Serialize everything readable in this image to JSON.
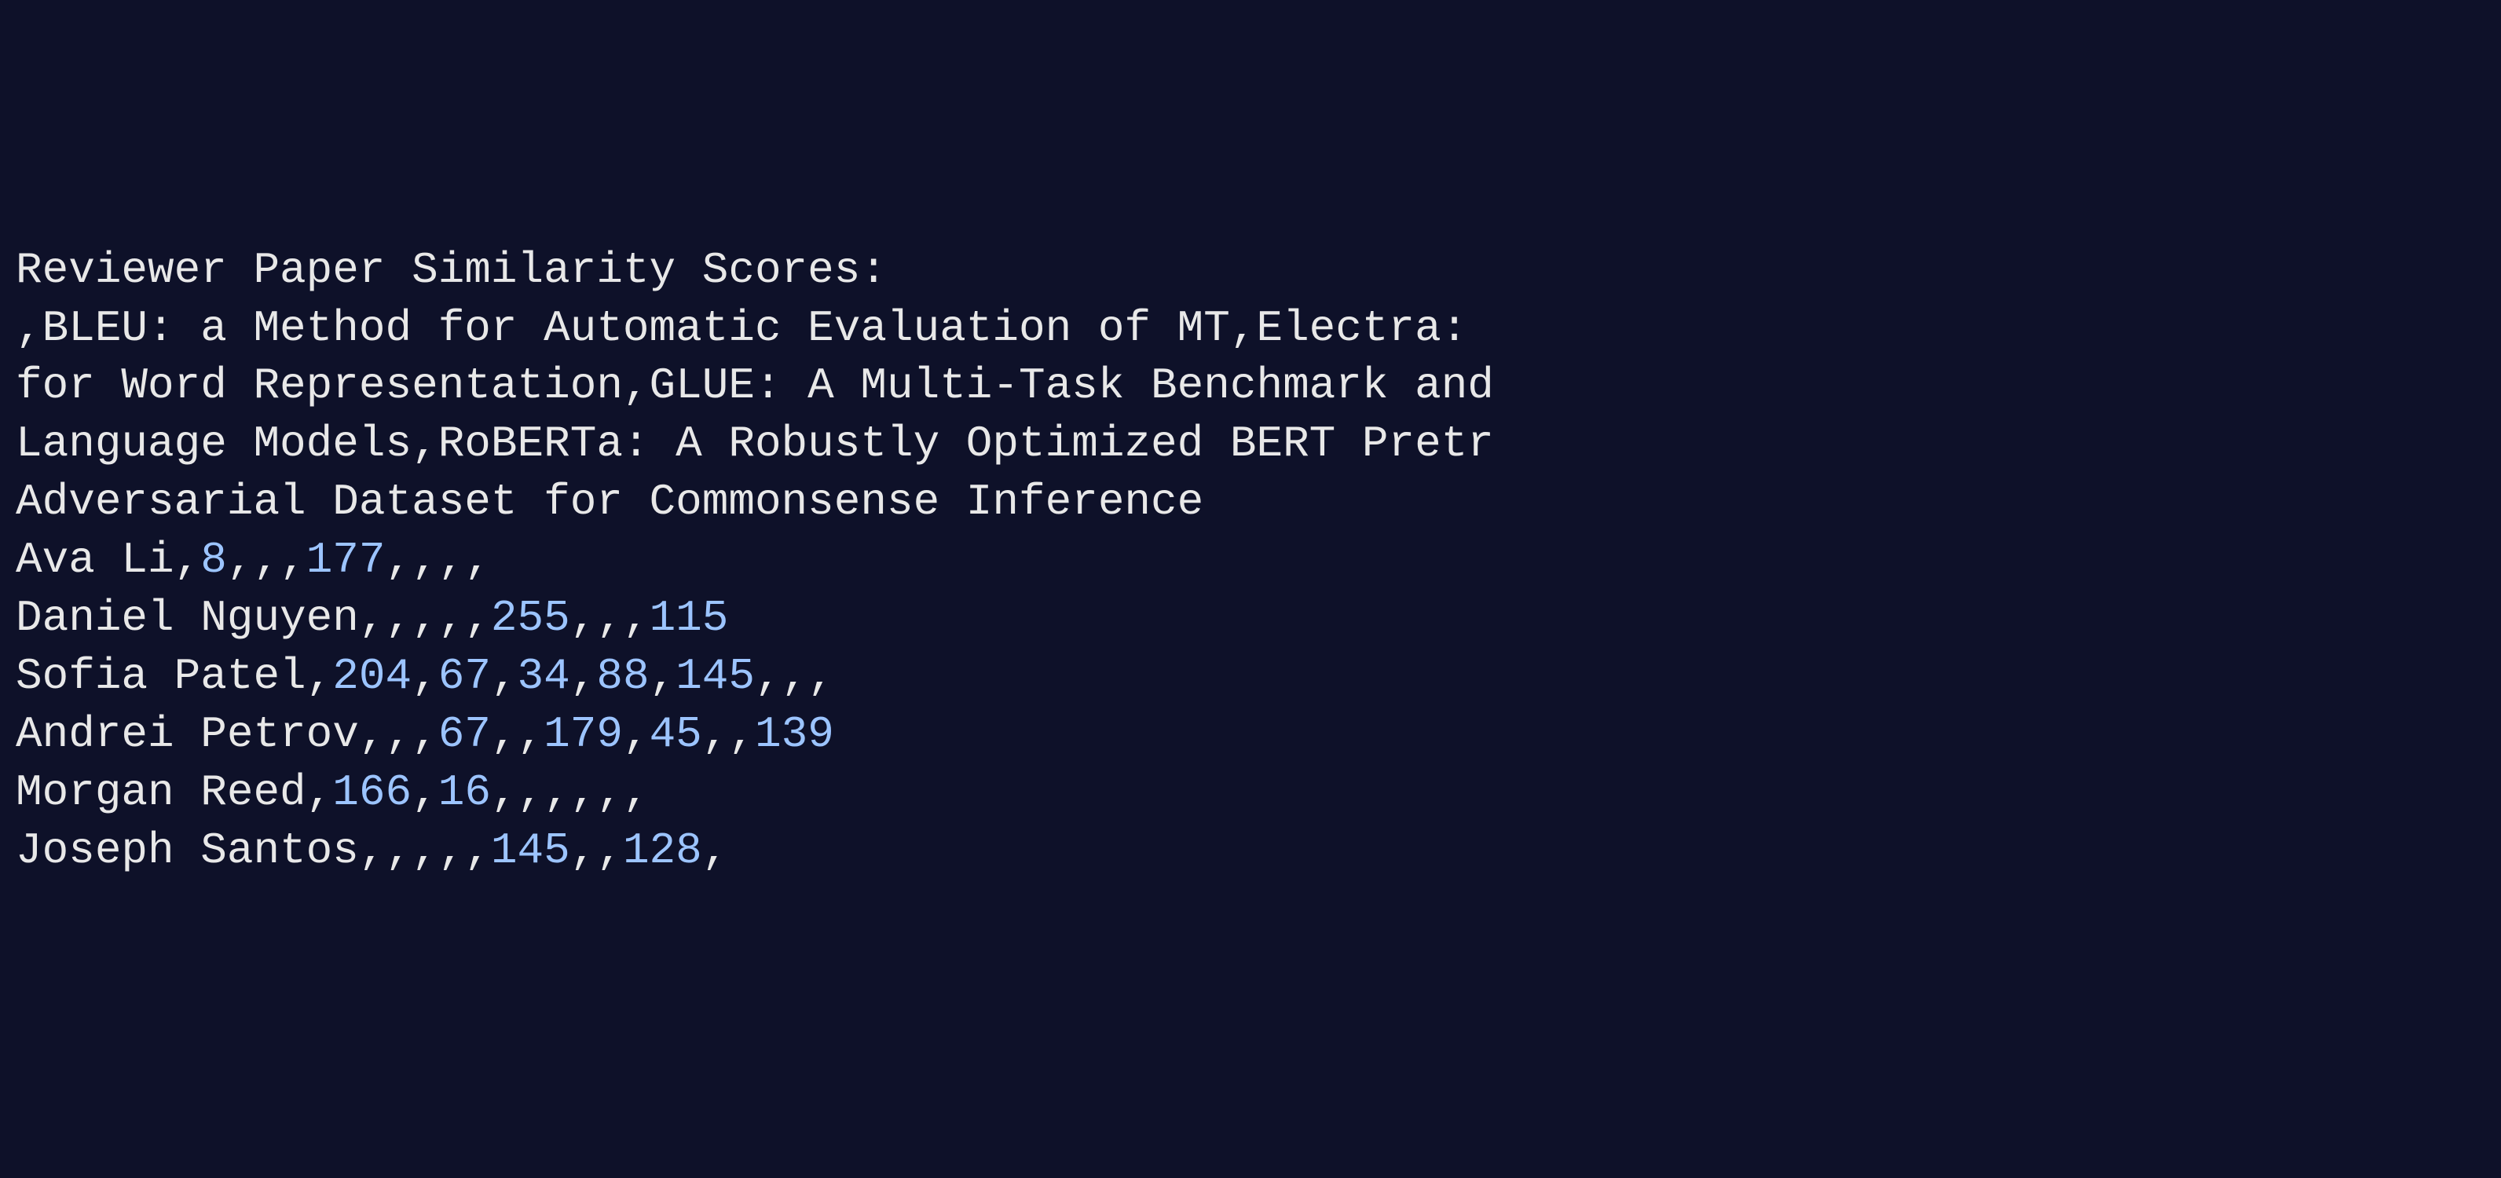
{
  "terminal": {
    "title": "Reviewer Paper Similarity Scores:",
    "header_line_2": ",BLEU: a Method for Automatic Evaluation of MT,Electra: ",
    "header_line_3": "for Word Representation,GLUE: A Multi-Task Benchmark and",
    "header_line_4": "Language Models,RoBERTa: A Robustly Optimized BERT Pretr",
    "header_line_5": "Adversarial Dataset for Commonsense Inference",
    "rows": [
      {
        "name": "Ava Li",
        "cells": [
          "8",
          "",
          "",
          "177",
          "",
          "",
          "",
          ""
        ]
      },
      {
        "name": "Daniel Nguyen",
        "cells": [
          "",
          "",
          "",
          "",
          "255",
          "",
          "",
          "115"
        ]
      },
      {
        "name": "Sofia Patel",
        "cells": [
          "204",
          "67",
          "34",
          "88",
          "145",
          "",
          "",
          ""
        ]
      },
      {
        "name": "Andrei Petrov",
        "cells": [
          "",
          "",
          "67",
          "",
          "179",
          "45",
          "",
          "139"
        ]
      },
      {
        "name": "Morgan Reed",
        "cells": [
          "166",
          "16",
          "",
          "",
          "",
          "",
          "",
          ""
        ]
      },
      {
        "name": "Joseph Santos",
        "cells": [
          "",
          "",
          "",
          "",
          "145",
          "",
          "128",
          ""
        ]
      }
    ]
  }
}
